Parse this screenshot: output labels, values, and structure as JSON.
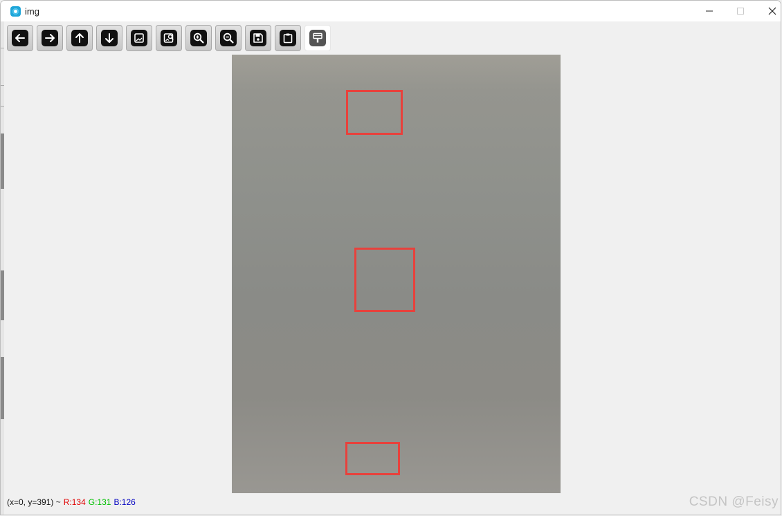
{
  "window": {
    "title": "img"
  },
  "toolbar": {
    "buttons": [
      {
        "icon": "arrow-left-icon"
      },
      {
        "icon": "arrow-right-icon"
      },
      {
        "icon": "arrow-up-icon"
      },
      {
        "icon": "arrow-down-icon"
      },
      {
        "icon": "image-icon"
      },
      {
        "icon": "image-search-icon"
      },
      {
        "icon": "zoom-in-icon"
      },
      {
        "icon": "zoom-out-icon"
      },
      {
        "icon": "save-icon"
      },
      {
        "icon": "clipboard-icon"
      },
      {
        "icon": "paint-brush-icon"
      }
    ]
  },
  "status": {
    "coords": "(x=0, y=391) ~",
    "r": "R:134",
    "g": "G:131",
    "b": "B:126",
    "r_color": "#e00000",
    "g_color": "#00c000",
    "b_color": "#0000c0"
  },
  "watermark": "CSDN @Feisy",
  "colors": {
    "roi": "#e8413c"
  }
}
